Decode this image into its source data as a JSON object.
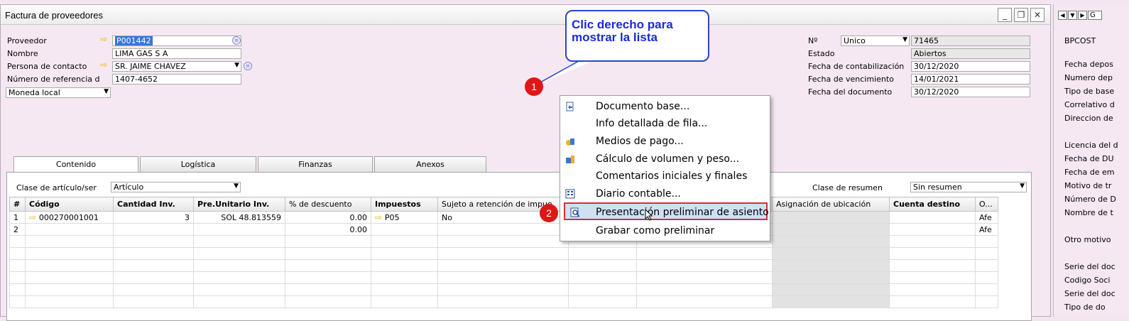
{
  "window": {
    "title": "Factura de proveedores",
    "buttons": [
      "_",
      "❐",
      "✕"
    ]
  },
  "header_left": {
    "proveedor_label": "Proveedor",
    "proveedor_value": "P001442",
    "nombre_label": "Nombre",
    "nombre_value": "LIMA GAS S A",
    "contacto_label": "Persona de contacto",
    "contacto_value": "SR. JAIME CHAVEZ",
    "referencia_label": "Número de referencia d",
    "referencia_value": "1407-4652",
    "moneda_value": "Moneda local"
  },
  "header_right": {
    "no_label": "Nº",
    "serie_value": "Unico",
    "numero_value": "71465",
    "estado_label": "Estado",
    "estado_value": "Abiertos",
    "contab_label": "Fecha de contabilización",
    "contab_value": "30/12/2020",
    "venc_label": "Fecha de vencimiento",
    "venc_value": "14/01/2021",
    "doc_label": "Fecha del documento",
    "doc_value": "30/12/2020"
  },
  "tabs": [
    "Contenido",
    "Logística",
    "Finanzas",
    "Anexos"
  ],
  "panel": {
    "clase_label": "Clase de artículo/ser",
    "clase_value": "Artículo",
    "resumen_label": "Clase de resumen",
    "resumen_value": "Sin resumen"
  },
  "grid": {
    "headers": [
      "#",
      "Código",
      "Cantidad Inv.",
      "Pre.Unitario Inv.",
      "% de descuento",
      "Impuestos",
      "Sujeto a retención de impue",
      "",
      "",
      "Asignación de ubicación",
      "Cuenta destino",
      "O..."
    ],
    "rows": [
      [
        "1",
        "000270001001",
        "3",
        "SOL 48.813559",
        "0.00",
        "P05",
        "No",
        "",
        "",
        "",
        "",
        "Afe"
      ],
      [
        "2",
        "",
        "",
        "",
        "0.00",
        "",
        "",
        "",
        "",
        "",
        "",
        "Afe"
      ]
    ]
  },
  "context_menu": {
    "items": [
      {
        "label": "Documento base...",
        "icon": "document-base-icon"
      },
      {
        "label": "Info detallada de fila...",
        "icon": ""
      },
      {
        "label": "Medios de pago...",
        "icon": "payment-icon"
      },
      {
        "label": "Cálculo de volumen y peso...",
        "icon": "volume-weight-icon"
      },
      {
        "label": "Comentarios iniciales y finales",
        "icon": ""
      },
      {
        "label": "Diario contable...",
        "icon": "journal-icon"
      },
      {
        "label": "Presentación preliminar de asiento",
        "icon": "preview-icon"
      },
      {
        "label": "Grabar como preliminar",
        "icon": ""
      }
    ]
  },
  "callout": {
    "line1": "Clic derecho para",
    "line2": "mostrar la lista"
  },
  "steps": [
    "1",
    "2"
  ],
  "right_panel": {
    "top_letter": "G",
    "labels": [
      "BPCOST",
      "Fecha depos",
      "Numero dep",
      "Tipo de base",
      "Correlativo d",
      "Direccion de",
      "Licencia del d",
      "Fecha de DU",
      "Fecha de em",
      "Motivo de tr",
      "Número de D",
      "Nombre de t",
      "Otro motivo",
      "Serie del doc",
      "Codigo Soci",
      "Serie del doc",
      "Tipo de do"
    ]
  },
  "colors": {
    "background": "#f5e8f2",
    "callout": "#2a45d0",
    "step": "#e01616",
    "highlight": "#cfe0f5",
    "highlight_border": "#d13232"
  }
}
